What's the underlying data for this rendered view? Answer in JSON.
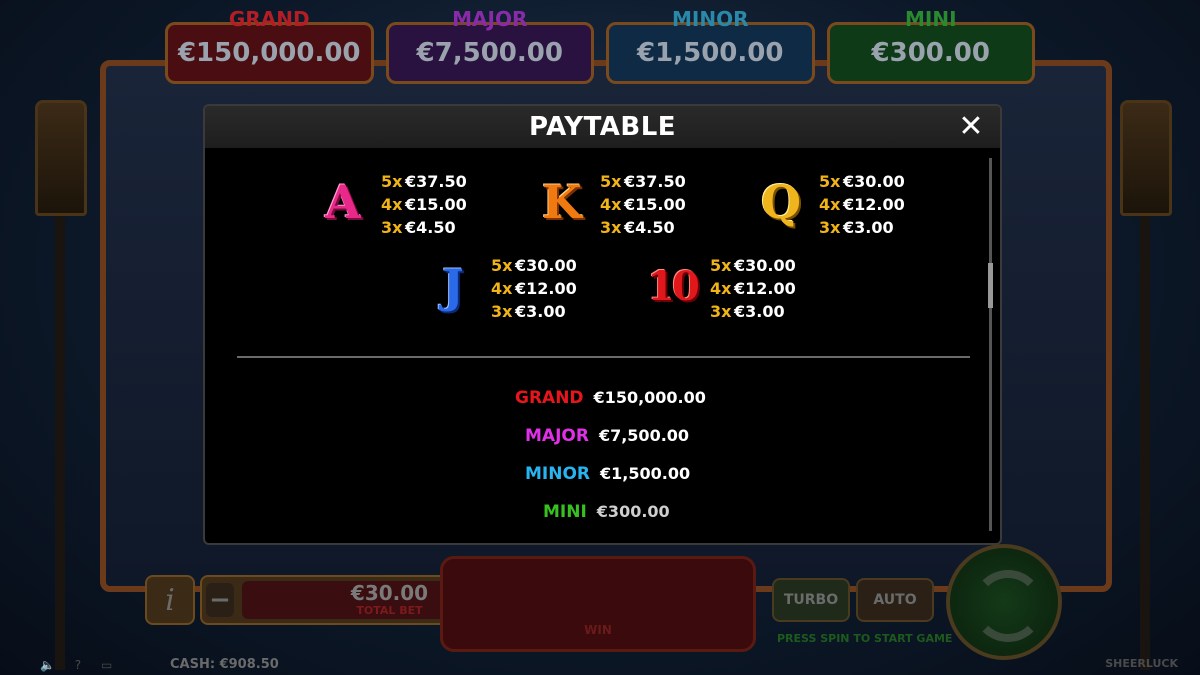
{
  "background": {
    "jackpots": [
      {
        "name": "GRAND",
        "value": "€150,000.00"
      },
      {
        "name": "MAJOR",
        "value": "€7,500.00"
      },
      {
        "name": "MINOR",
        "value": "€1,500.00"
      },
      {
        "name": "MINI",
        "value": "€300.00"
      }
    ],
    "info_label": "i",
    "bet_minus": "−",
    "bet_plus": "+",
    "total_bet_value": "€30.00",
    "total_bet_label": "TOTAL BET",
    "win_label": "WIN",
    "turbo_label": "TURBO",
    "auto_label": "AUTO",
    "press_spin": "PRESS SPIN TO START GAME",
    "cash": "CASH: €908.50",
    "brand": "SHEERLUCK",
    "statusbar_icons": "🔈 ? ▭"
  },
  "paytable": {
    "title": "PAYTABLE",
    "close_icon": "✕",
    "symbols": [
      {
        "symbol": "A",
        "icon_name": "a-symbol-icon",
        "pays": [
          {
            "mult": "5x",
            "amount": "€37.50"
          },
          {
            "mult": "4x",
            "amount": "€15.00"
          },
          {
            "mult": "3x",
            "amount": "€4.50"
          }
        ]
      },
      {
        "symbol": "K",
        "icon_name": "k-symbol-icon",
        "pays": [
          {
            "mult": "5x",
            "amount": "€37.50"
          },
          {
            "mult": "4x",
            "amount": "€15.00"
          },
          {
            "mult": "3x",
            "amount": "€4.50"
          }
        ]
      },
      {
        "symbol": "Q",
        "icon_name": "q-symbol-icon",
        "pays": [
          {
            "mult": "5x",
            "amount": "€30.00"
          },
          {
            "mult": "4x",
            "amount": "€12.00"
          },
          {
            "mult": "3x",
            "amount": "€3.00"
          }
        ]
      },
      {
        "symbol": "J",
        "icon_name": "j-symbol-icon",
        "pays": [
          {
            "mult": "5x",
            "amount": "€30.00"
          },
          {
            "mult": "4x",
            "amount": "€12.00"
          },
          {
            "mult": "3x",
            "amount": "€3.00"
          }
        ]
      },
      {
        "symbol": "10",
        "icon_name": "ten-symbol-icon",
        "pays": [
          {
            "mult": "5x",
            "amount": "€30.00"
          },
          {
            "mult": "4x",
            "amount": "€12.00"
          },
          {
            "mult": "3x",
            "amount": "€3.00"
          }
        ]
      }
    ],
    "jackpots": [
      {
        "name": "GRAND",
        "value": "€150,000.00",
        "color": "#e8161c"
      },
      {
        "name": "MAJOR",
        "value": "€7,500.00",
        "color": "#e030e8"
      },
      {
        "name": "MINOR",
        "value": "€1,500.00",
        "color": "#28b4f0"
      },
      {
        "name": "MINI",
        "value": "€300.00",
        "color": "#38c020"
      }
    ]
  }
}
